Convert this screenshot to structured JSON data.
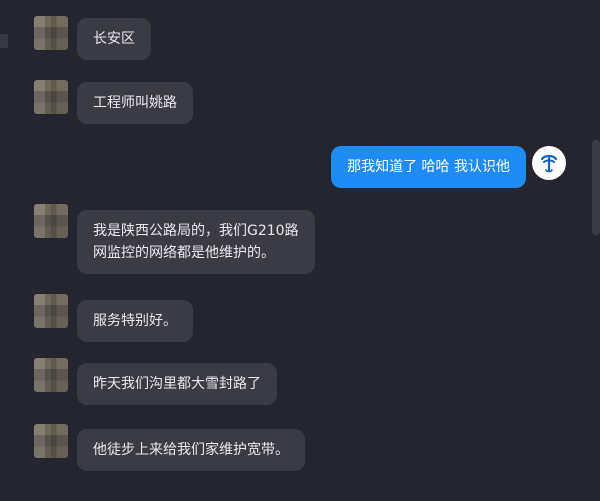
{
  "messages": [
    {
      "side": "left",
      "text": "长安区"
    },
    {
      "side": "left",
      "text": "工程师叫姚路"
    },
    {
      "side": "right",
      "text": "那我知道了 哈哈 我认识他"
    },
    {
      "side": "left",
      "lines": [
        "我是陕西公路局的，我们G210路",
        "网监控的网络都是他维护的。"
      ]
    },
    {
      "side": "left",
      "text": "服务特别好。"
    },
    {
      "side": "left",
      "text": "昨天我们沟里都大雪封路了"
    },
    {
      "side": "left",
      "text": "他徒步上来给我们家维护宽带。"
    }
  ],
  "colors": {
    "background": "#25252f",
    "incoming_bubble": "#3b3b45",
    "outgoing_bubble": "#1f8bf5",
    "text": "#e9e9ee"
  },
  "icons": {
    "contact_avatar": "blurred-photo-avatar",
    "self_avatar": "china-telecom-logo-icon"
  }
}
